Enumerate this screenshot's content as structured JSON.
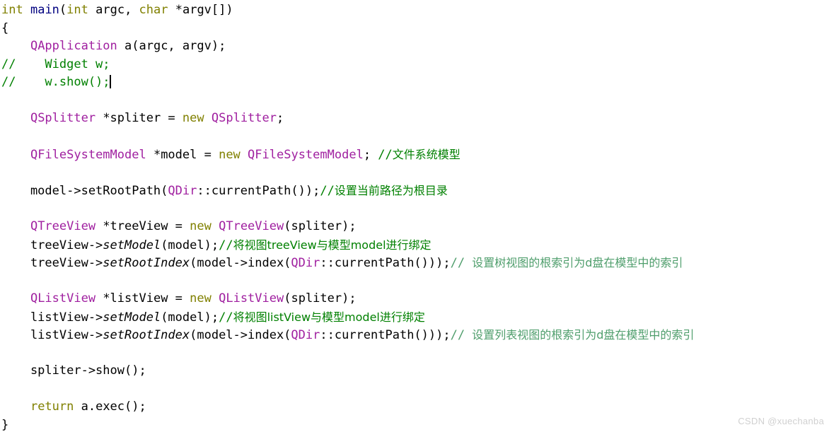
{
  "editor": {
    "language": "C++",
    "background_color": "#ffffff",
    "default_text_color": "#000000",
    "syntax_colors": {
      "keyword": "#808000",
      "function": "#000080",
      "type": "#a020a0",
      "comment": "#008000",
      "comment_dim": "#4f9e6c",
      "plain": "#000000"
    },
    "caret_visible": true
  },
  "code": {
    "lines": [
      {
        "id": "line-1",
        "plain": "int main(int argc, char *argv[])",
        "tokens": [
          {
            "text": "int",
            "kind": "keyword"
          },
          {
            "text": " ",
            "kind": "plain"
          },
          {
            "text": "main",
            "kind": "func"
          },
          {
            "text": "(",
            "kind": "plain"
          },
          {
            "text": "int",
            "kind": "keyword"
          },
          {
            "text": " argc, ",
            "kind": "plain"
          },
          {
            "text": "char",
            "kind": "keyword"
          },
          {
            "text": " *argv[])",
            "kind": "plain"
          }
        ]
      },
      {
        "id": "line-2",
        "plain": "{",
        "tokens": [
          {
            "text": "{",
            "kind": "plain"
          }
        ]
      },
      {
        "id": "line-3",
        "plain": "    QApplication a(argc, argv);",
        "tokens": [
          {
            "text": "    ",
            "kind": "plain"
          },
          {
            "text": "QApplication",
            "kind": "type"
          },
          {
            "text": " a(argc, argv);",
            "kind": "plain"
          }
        ]
      },
      {
        "id": "line-4",
        "plain": "//    Widget w;",
        "tokens": [
          {
            "text": "//    Widget w;",
            "kind": "comment"
          }
        ]
      },
      {
        "id": "line-5",
        "plain": "//    w.show();",
        "tokens": [
          {
            "text": "//    w.show();",
            "kind": "comment"
          },
          {
            "text": "",
            "kind": "caret"
          }
        ]
      },
      {
        "id": "line-6",
        "plain": "",
        "tokens": []
      },
      {
        "id": "line-7",
        "plain": "    QSplitter *spliter = new QSplitter;",
        "tokens": [
          {
            "text": "    ",
            "kind": "plain"
          },
          {
            "text": "QSplitter",
            "kind": "type"
          },
          {
            "text": " *spliter = ",
            "kind": "plain"
          },
          {
            "text": "new",
            "kind": "keyword"
          },
          {
            "text": " ",
            "kind": "plain"
          },
          {
            "text": "QSplitter",
            "kind": "type"
          },
          {
            "text": ";",
            "kind": "plain"
          }
        ]
      },
      {
        "id": "line-8",
        "plain": "",
        "tokens": []
      },
      {
        "id": "line-9",
        "plain": "    QFileSystemModel *model = new QFileSystemModel; //文件系统模型",
        "tokens": [
          {
            "text": "    ",
            "kind": "plain"
          },
          {
            "text": "QFileSystemModel",
            "kind": "type"
          },
          {
            "text": " *model = ",
            "kind": "plain"
          },
          {
            "text": "new",
            "kind": "keyword"
          },
          {
            "text": " ",
            "kind": "plain"
          },
          {
            "text": "QFileSystemModel",
            "kind": "type"
          },
          {
            "text": "; ",
            "kind": "plain"
          },
          {
            "text": "//",
            "kind": "comment"
          },
          {
            "text": "文件系统模型",
            "kind": "comment-cjk"
          }
        ]
      },
      {
        "id": "line-10",
        "plain": "",
        "tokens": []
      },
      {
        "id": "line-11",
        "plain": "    model->setRootPath(QDir::currentPath());//设置当前路径为根目录",
        "tokens": [
          {
            "text": "    model->setRootPath(",
            "kind": "plain"
          },
          {
            "text": "QDir",
            "kind": "type"
          },
          {
            "text": "::currentPath());",
            "kind": "plain"
          },
          {
            "text": "//",
            "kind": "comment"
          },
          {
            "text": "设置当前路径为根目录",
            "kind": "comment-cjk"
          }
        ]
      },
      {
        "id": "line-12",
        "plain": "",
        "tokens": []
      },
      {
        "id": "line-13",
        "plain": "    QTreeView *treeView = new QTreeView(spliter);",
        "tokens": [
          {
            "text": "    ",
            "kind": "plain"
          },
          {
            "text": "QTreeView",
            "kind": "type"
          },
          {
            "text": " *treeView = ",
            "kind": "plain"
          },
          {
            "text": "new",
            "kind": "keyword"
          },
          {
            "text": " ",
            "kind": "plain"
          },
          {
            "text": "QTreeView",
            "kind": "type"
          },
          {
            "text": "(spliter);",
            "kind": "plain"
          }
        ]
      },
      {
        "id": "line-14",
        "plain": "    treeView->setModel(model);//将视图treeView与模型model进行绑定",
        "tokens": [
          {
            "text": "    treeView->",
            "kind": "plain"
          },
          {
            "text": "setModel",
            "kind": "italic"
          },
          {
            "text": "(model);",
            "kind": "plain"
          },
          {
            "text": "//",
            "kind": "comment"
          },
          {
            "text": "将视图treeView与模型model进行绑定",
            "kind": "comment-cjk"
          }
        ]
      },
      {
        "id": "line-15",
        "plain": "    treeView->setRootIndex(model->index(QDir::currentPath()));//  设置树视图的根索引为d盘在模型中的索引",
        "tokens": [
          {
            "text": "    treeView->",
            "kind": "plain"
          },
          {
            "text": "setRootIndex",
            "kind": "italic"
          },
          {
            "text": "(model->index(",
            "kind": "plain"
          },
          {
            "text": "QDir",
            "kind": "type"
          },
          {
            "text": "::currentPath()));",
            "kind": "plain"
          },
          {
            "text": "//",
            "kind": "comment-dim"
          },
          {
            "text": "  设置树视图的根索引为d盘在模型中的索引",
            "kind": "comment-dim-cjk"
          }
        ]
      },
      {
        "id": "line-16",
        "plain": "",
        "tokens": []
      },
      {
        "id": "line-17",
        "plain": "    QListView *listView = new QListView(spliter);",
        "tokens": [
          {
            "text": "    ",
            "kind": "plain"
          },
          {
            "text": "QListView",
            "kind": "type"
          },
          {
            "text": " *listView = ",
            "kind": "plain"
          },
          {
            "text": "new",
            "kind": "keyword"
          },
          {
            "text": " ",
            "kind": "plain"
          },
          {
            "text": "QListView",
            "kind": "type"
          },
          {
            "text": "(spliter);",
            "kind": "plain"
          }
        ]
      },
      {
        "id": "line-18",
        "plain": "    listView->setModel(model);//将视图listView与模型model进行绑定",
        "tokens": [
          {
            "text": "    listView->",
            "kind": "plain"
          },
          {
            "text": "setModel",
            "kind": "italic"
          },
          {
            "text": "(model);",
            "kind": "plain"
          },
          {
            "text": "//",
            "kind": "comment"
          },
          {
            "text": "将视图listView与模型model进行绑定",
            "kind": "comment-cjk"
          }
        ]
      },
      {
        "id": "line-19",
        "plain": "    listView->setRootIndex(model->index(QDir::currentPath()));//  设置列表视图的根索引为d盘在模型中的索引",
        "tokens": [
          {
            "text": "    listView->",
            "kind": "plain"
          },
          {
            "text": "setRootIndex",
            "kind": "italic"
          },
          {
            "text": "(model->index(",
            "kind": "plain"
          },
          {
            "text": "QDir",
            "kind": "type"
          },
          {
            "text": "::currentPath()));",
            "kind": "plain"
          },
          {
            "text": "//",
            "kind": "comment-dim"
          },
          {
            "text": "  设置列表视图的根索引为d盘在模型中的索引",
            "kind": "comment-dim-cjk"
          }
        ]
      },
      {
        "id": "line-20",
        "plain": "",
        "tokens": []
      },
      {
        "id": "line-21",
        "plain": "    spliter->show();",
        "tokens": [
          {
            "text": "    spliter->show();",
            "kind": "plain"
          }
        ]
      },
      {
        "id": "line-22",
        "plain": "",
        "tokens": []
      },
      {
        "id": "line-23",
        "plain": "    return a.exec();",
        "tokens": [
          {
            "text": "    ",
            "kind": "plain"
          },
          {
            "text": "return",
            "kind": "keyword"
          },
          {
            "text": " a.exec();",
            "kind": "plain"
          }
        ]
      },
      {
        "id": "line-24",
        "plain": "}",
        "tokens": [
          {
            "text": "}",
            "kind": "plain"
          }
        ]
      }
    ]
  },
  "watermark": {
    "text": "CSDN @xuechanba",
    "color": "#d0d0d0"
  }
}
